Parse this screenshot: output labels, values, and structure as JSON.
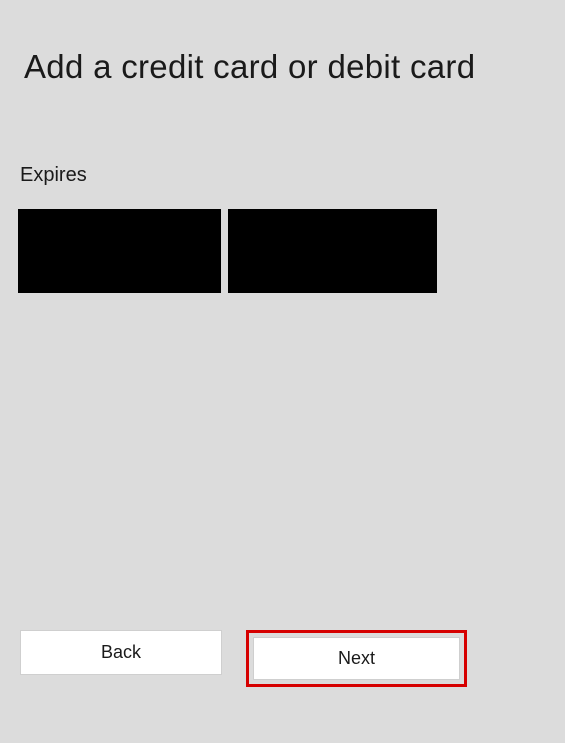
{
  "title": "Add a credit card or debit card",
  "expires": {
    "label": "Expires",
    "month_value": "",
    "year_value": ""
  },
  "buttons": {
    "back": "Back",
    "next": "Next"
  }
}
